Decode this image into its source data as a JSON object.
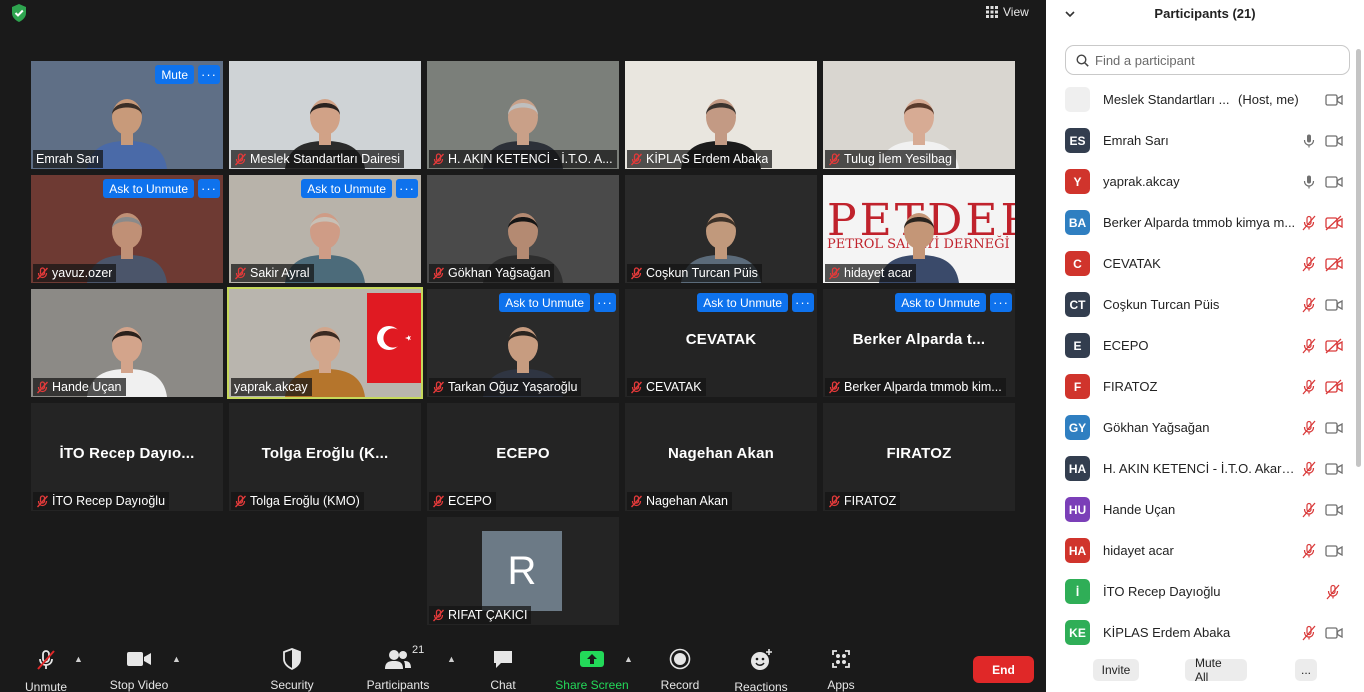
{
  "window": {
    "view_label": "View"
  },
  "tiles": [
    {
      "name": "Emrah Sarı",
      "video": true,
      "bg": "#5f6f86",
      "shirt": "#4a6aa8",
      "skin": "#c89a7a",
      "hair": "#3a2f28",
      "muted": false,
      "buttons": [
        "Mute",
        "···"
      ]
    },
    {
      "name": "Meslek Standartları Dairesi",
      "video": true,
      "bg": "#cfd3d6",
      "shirt": "#2b2b2b",
      "skin": "#d1a287",
      "hair": "#2a2320",
      "muted": true,
      "buttons": []
    },
    {
      "name": "H. AKIN KETENCİ - İ.T.O. A...",
      "video": true,
      "bg": "#7b7f7a",
      "shirt": "#2c3038",
      "skin": "#c9a088",
      "hair": "#bfbfbf",
      "muted": true,
      "buttons": []
    },
    {
      "name": "KİPLAS Erdem Abaka",
      "video": true,
      "bg": "#e9e6df",
      "shirt": "#1c1c1c",
      "skin": "#c39a84",
      "hair": "#3a332e",
      "muted": true,
      "buttons": []
    },
    {
      "name": "Tulug İlem Yesilbag",
      "video": true,
      "bg": "#d9d6d0",
      "shirt": "#f1f1f1",
      "skin": "#d7ab94",
      "hair": "#5a3b2c",
      "muted": true,
      "buttons": []
    },
    {
      "name": "yavuz.ozer",
      "video": true,
      "bg": "#6e3a33",
      "shirt": "#4b556a",
      "skin": "#c09076",
      "hair": "#8a8a8a",
      "muted": true,
      "buttons": [
        "Ask to Unmute",
        "···"
      ]
    },
    {
      "name": "Sakir Ayral",
      "video": true,
      "bg": "#b8b3aa",
      "shirt": "#4c6b7a",
      "skin": "#cf9c86",
      "hair": "#c8c0b6",
      "muted": true,
      "buttons": [
        "Ask to Unmute",
        "···"
      ]
    },
    {
      "name": "Gökhan Yağsağan",
      "video": true,
      "bg": "#4a4a4a",
      "shirt": "#2e2e2e",
      "skin": "#b48a72",
      "hair": "#151515",
      "muted": true,
      "buttons": []
    },
    {
      "name": "Coşkun Turcan Püis",
      "video": true,
      "bg": "#2a2a2a",
      "shirt": "#5b6b7a",
      "skin": "#c1997c",
      "hair": "#3b3027",
      "muted": true,
      "buttons": []
    },
    {
      "name": "hidayet acar",
      "video": true,
      "bg": "#f4f4f4",
      "shirt": "#3a4a6a",
      "skin": "#c49677",
      "hair": "#2a241f",
      "muted": true,
      "buttons": [],
      "logo": true
    },
    {
      "name": "Hande Uçan",
      "video": true,
      "bg": "#8c8a86",
      "shirt": "#f0f0f0",
      "skin": "#d3a48b",
      "hair": "#2b211c",
      "muted": true,
      "buttons": []
    },
    {
      "name": "yaprak.akcay",
      "video": true,
      "bg": "#b9b5ae",
      "shirt": "#b5752c",
      "skin": "#d2a68c",
      "hair": "#3a2a22",
      "muted": false,
      "active": true,
      "buttons": [],
      "flag": true
    },
    {
      "name": "Tarkan Oğuz Yaşaroğlu",
      "video": true,
      "bg": "#2a2a2a",
      "shirt": "#2f3542",
      "skin": "#c79c80",
      "hair": "#2a241f",
      "muted": true,
      "buttons": [
        "Ask to Unmute",
        "···"
      ]
    },
    {
      "name": "CEVATAK",
      "video": false,
      "bigname": "CEVATAK",
      "muted": true,
      "buttons": [
        "Ask to Unmute",
        "···"
      ]
    },
    {
      "name": "Berker Alparda tmmob kim...",
      "video": false,
      "bigname": "Berker Alparda t...",
      "muted": true,
      "buttons": [
        "Ask to Unmute",
        "···"
      ]
    },
    {
      "name": "İTO Recep Dayıoğlu",
      "video": false,
      "bigname": "İTO Recep Dayıo...",
      "muted": true,
      "buttons": []
    },
    {
      "name": "Tolga Eroğlu (KMO)",
      "video": false,
      "bigname": "Tolga Eroğlu (K...",
      "muted": true,
      "buttons": []
    },
    {
      "name": "ECEPO",
      "video": false,
      "bigname": "ECEPO",
      "muted": true,
      "buttons": []
    },
    {
      "name": "Nagehan Akan",
      "video": false,
      "bigname": "Nagehan Akan",
      "muted": true,
      "buttons": []
    },
    {
      "name": "FIRATOZ",
      "video": false,
      "bigname": "FIRATOZ",
      "muted": true,
      "buttons": []
    },
    {
      "name": "RIFAT ÇAKICI",
      "video": false,
      "avatar_letter": "R",
      "muted": true,
      "buttons": []
    }
  ],
  "tile_logo": {
    "line1": "PETDER",
    "line2": "PETROL SANAYİ DERNEĞİ"
  },
  "toolbar": {
    "unmute": "Unmute",
    "stop_video": "Stop Video",
    "security": "Security",
    "participants": "Participants",
    "participants_count": "21",
    "chat": "Chat",
    "share_screen": "Share Screen",
    "record": "Record",
    "reactions": "Reactions",
    "apps": "Apps",
    "end": "End"
  },
  "panel": {
    "title": "Participants (21)",
    "search_placeholder": "Find a participant",
    "invite": "Invite",
    "mute_all": "Mute All",
    "more": "...",
    "participants": [
      {
        "initials": "",
        "color": "#efefef",
        "name": "Meslek Standartları ...",
        "host": "(Host, me)",
        "mic": "on-muted-none",
        "cam": "on"
      },
      {
        "initials": "ES",
        "color": "#333e4f",
        "name": "Emrah Sarı",
        "mic": "on",
        "cam": "on"
      },
      {
        "initials": "Y",
        "color": "#d0342c",
        "name": "yaprak.akcay",
        "mic": "on",
        "cam": "on"
      },
      {
        "initials": "BA",
        "color": "#2f7fc1",
        "name": "Berker Alparda tmmob kimya m...",
        "mic": "off",
        "cam": "off"
      },
      {
        "initials": "C",
        "color": "#d0342c",
        "name": "CEVATAK",
        "mic": "off",
        "cam": "off"
      },
      {
        "initials": "CT",
        "color": "#333e4f",
        "name": "Coşkun Turcan Püis",
        "mic": "off",
        "cam": "on"
      },
      {
        "initials": "E",
        "color": "#333e4f",
        "name": "ECEPO",
        "mic": "off",
        "cam": "off"
      },
      {
        "initials": "F",
        "color": "#d0342c",
        "name": "FIRATOZ",
        "mic": "off",
        "cam": "off"
      },
      {
        "initials": "GY",
        "color": "#2f7fc1",
        "name": "Gökhan Yağsağan",
        "mic": "off",
        "cam": "on"
      },
      {
        "initials": "HA",
        "color": "#333e4f",
        "name": "H. AKIN KETENCİ - İ.T.O. Akarya...",
        "mic": "off",
        "cam": "on"
      },
      {
        "initials": "HU",
        "color": "#7b3fb8",
        "name": "Hande Uçan",
        "mic": "off",
        "cam": "on"
      },
      {
        "initials": "HA",
        "color": "#d0342c",
        "name": "hidayet acar",
        "mic": "off",
        "cam": "on"
      },
      {
        "initials": "İ",
        "color": "#2fae57",
        "name": "İTO Recep Dayıoğlu",
        "mic": "off-only",
        "cam": "none"
      },
      {
        "initials": "KE",
        "color": "#2fae57",
        "name": "KİPLAS Erdem Abaka",
        "mic": "off",
        "cam": "on"
      }
    ]
  }
}
